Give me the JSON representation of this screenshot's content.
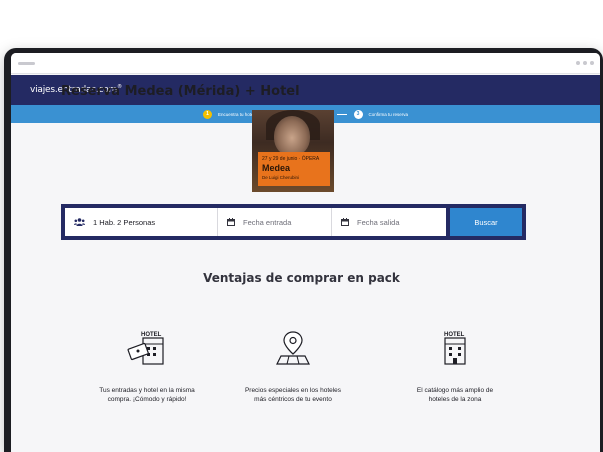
{
  "header": {
    "logo": "viajes.entradas.com",
    "logo_mark": "®"
  },
  "steps": [
    {
      "num": "1",
      "label": "Encuentra tu hotel",
      "active": true
    },
    {
      "num": "2",
      "label": "Elige tus entradas",
      "active": false
    },
    {
      "num": "3",
      "label": "Confirma tu reserva",
      "active": false
    }
  ],
  "page": {
    "title": "Reserva Medea (Mérida) + Hotel"
  },
  "poster": {
    "date": "27 y 29 de junio · ÓPERA",
    "name": "Medea",
    "author": "De Luigi Cherubini"
  },
  "search": {
    "guests": "1 Hab. 2 Personas",
    "checkin_placeholder": "Fecha entrada",
    "checkout_placeholder": "Fecha salida",
    "button": "Buscar"
  },
  "benefits": {
    "title": "Ventajas de comprar en pack",
    "items": [
      {
        "icon_label": "HOTEL",
        "text_line1": "Tus entradas y hotel en la misma",
        "text_line2": "compra. ¡Cómodo y rápido!"
      },
      {
        "icon_label": "",
        "text_line1": "Precios especiales en los hoteles",
        "text_line2": "más céntricos de tu evento"
      },
      {
        "icon_label": "HOTEL",
        "text_line1": "El catálogo más amplio de",
        "text_line2": "hoteles de la zona"
      }
    ]
  },
  "colors": {
    "header_bg": "#242a63",
    "steps_bg": "#3a91d2",
    "step_active": "#f4c000",
    "button_bg": "#2f86cf"
  }
}
